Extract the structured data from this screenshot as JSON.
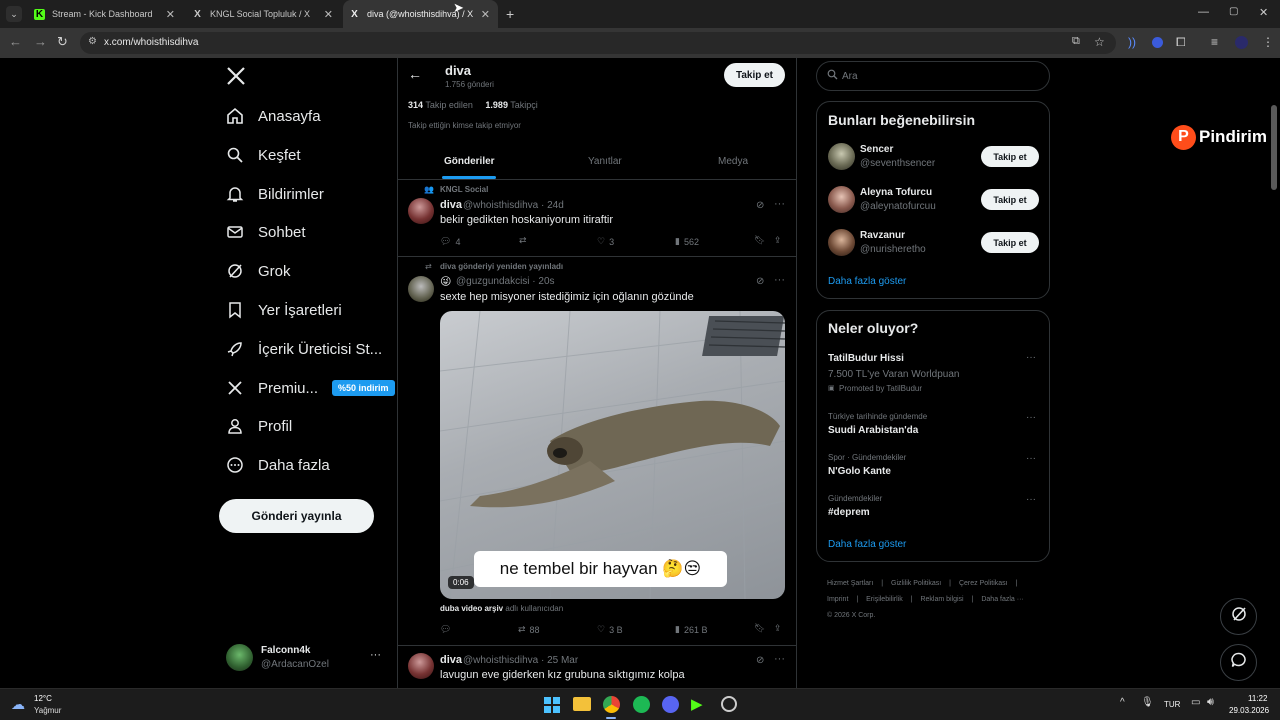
{
  "browser": {
    "tabs": [
      {
        "label": "Stream - Kick Dashboard",
        "favicon": "K"
      },
      {
        "label": "KNGL Social Topluluk / X",
        "favicon": "X"
      },
      {
        "label": "diva (@whoisthisdihva) / X",
        "favicon": "X"
      }
    ],
    "url": "x.com/whoisthisdihva"
  },
  "sidebar": {
    "items": [
      {
        "label": "Anasayfa",
        "icon": "home-icon"
      },
      {
        "label": "Keşfet",
        "icon": "search-icon"
      },
      {
        "label": "Bildirimler",
        "icon": "bell-icon"
      },
      {
        "label": "Sohbet",
        "icon": "mail-icon"
      },
      {
        "label": "Grok",
        "icon": "grok-icon"
      },
      {
        "label": "Yer İşaretleri",
        "icon": "bookmark-icon"
      },
      {
        "label": "İçerik Üreticisi St...",
        "icon": "rocket-icon"
      },
      {
        "label": "Premiu...",
        "icon": "x-logo-icon",
        "badge": "%50 indirim"
      },
      {
        "label": "Profil",
        "icon": "person-icon"
      },
      {
        "label": "Daha fazla",
        "icon": "more-circle-icon"
      }
    ],
    "post_button": "Gönderi yayınla",
    "account": {
      "name": "Falconn4k",
      "handle": "@ArdacanOzel",
      "more": "···"
    }
  },
  "profile": {
    "name": "diva",
    "post_count": "1.756 gönderi",
    "follow_button": "Takip et",
    "following_count": "314",
    "following_label": "Takip edilen",
    "followers_count": "1.989",
    "followers_label": "Takipçi",
    "note": "Takip ettiğin kimse takip etmiyor",
    "tabs": [
      "Gönderiler",
      "Yanıtlar",
      "Medya"
    ]
  },
  "tweets": [
    {
      "context": "KNGL Social",
      "name": "diva",
      "handle": "@whoisthisdihva · 24d",
      "text": "bekir gedikten hoskaniyorum itiraftir",
      "replies": "4",
      "likes": "3",
      "views": "562"
    },
    {
      "context": "diva gönderiyi yeniden yayınladı",
      "name": "😜",
      "handle": "@guzgundakcisi · 20s",
      "text": "sexte hep misyoner istediğimiz için oğlanın gözünde",
      "caption": "ne tembel bir hayvan 🤔😒",
      "duration": "0:06",
      "source_name": "duba video arşiv",
      "source_suffix": "adlı kullanıcıdan",
      "retweets": "88",
      "likes": "3 B",
      "views": "261 B"
    },
    {
      "name": "diva",
      "handle": "@whoisthisdihva · 25 Mar",
      "text": "lavugun eve giderken kız grubuna sıktıgımız kolpa"
    }
  ],
  "right": {
    "search_placeholder": "Ara",
    "suggest_title": "Bunları beğenebilirsin",
    "suggestions": [
      {
        "name": "Sencer",
        "handle": "@seventhsencer",
        "button": "Takip et"
      },
      {
        "name": "Aleyna Tofurcu",
        "handle": "@aleynatofurcuu",
        "button": "Takip et"
      },
      {
        "name": "Ravzanur",
        "handle": "@nurisheretho",
        "button": "Takip et"
      }
    ],
    "show_more": "Daha fazla göster",
    "trends_title": "Neler oluyor?",
    "trends": [
      {
        "meta": "",
        "title": "TatilBudur Hissi",
        "sub": "7.500 TL'ye Varan Worldpuan",
        "promo": "Promoted by TatilBudur"
      },
      {
        "meta": "Türkiye tarihinde gündemde",
        "title": "Suudi Arabistan'da"
      },
      {
        "meta": "Spor · Gündemdekiler",
        "title": "N'Golo Kante"
      },
      {
        "meta": "Gündemdekiler",
        "title": "#deprem"
      }
    ],
    "trends_more": "Daha fazla göster",
    "footer": [
      "Hizmet Şartları",
      "|",
      "Gizlilik Politikası",
      "|",
      "Çerez Politikası",
      "|",
      "Imprint",
      "|",
      "Erişilebilirlik",
      "|",
      "Reklam bilgisi",
      "|",
      "Daha fazla ···"
    ],
    "copyright": "© 2026 X Corp."
  },
  "watermark": "Pindirim",
  "taskbar": {
    "temp": "12°C",
    "weather": "Yağmur",
    "lang": "TUR",
    "time": "11:22",
    "date": "29.03.2026"
  },
  "colors": {
    "accent": "#1d9bf0",
    "badge": "#1d9bf0",
    "watermark": "#ff4d1a"
  }
}
